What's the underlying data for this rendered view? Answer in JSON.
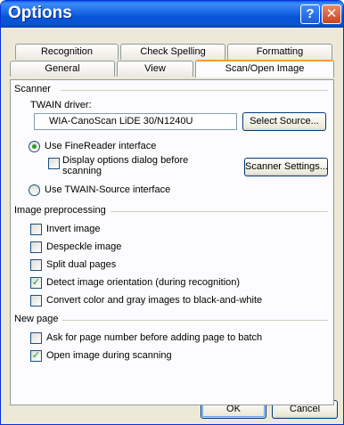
{
  "window": {
    "title": "Options",
    "help_glyph": "?",
    "close_glyph": "✕"
  },
  "tabs": {
    "row1": [
      {
        "label": "Recognition"
      },
      {
        "label": "Check Spelling"
      },
      {
        "label": "Formatting"
      }
    ],
    "row2": [
      {
        "label": "General"
      },
      {
        "label": "View"
      },
      {
        "label": "Scan/Open Image",
        "active": true
      }
    ]
  },
  "scanner": {
    "group_label": "Scanner",
    "twain_label": "TWAIN driver:",
    "twain_value": "WIA-CanoScan LiDE 30/N1240U",
    "select_source": "Select Source...",
    "radio_finereader": "Use FineReader interface",
    "display_options_line1": "Display options dialog before",
    "display_options_line2": "scanning",
    "scanner_settings": "Scanner Settings...",
    "radio_twain": "Use TWAIN-Source interface",
    "finereader_selected": true,
    "display_options_checked": false
  },
  "preprocessing": {
    "group_label": "Image preprocessing",
    "items": [
      {
        "label": "Invert image",
        "checked": false
      },
      {
        "label": "Despeckle image",
        "checked": false
      },
      {
        "label": "Split dual pages",
        "checked": false
      },
      {
        "label": "Detect image orientation (during recognition)",
        "checked": true
      },
      {
        "label": "Convert color and gray images to black-and-white",
        "checked": false
      }
    ]
  },
  "new_page": {
    "group_label": "New page",
    "items": [
      {
        "label": "Ask for page number before adding page to batch",
        "checked": false
      },
      {
        "label": "Open image during scanning",
        "checked": true
      }
    ]
  },
  "footer": {
    "ok": "OK",
    "cancel": "Cancel"
  },
  "colors": {
    "titlebar": "#0a54d2",
    "dialog_bg": "#ece9d8",
    "active_tab_accent": "#ff9933",
    "check_mark": "#21a121"
  }
}
